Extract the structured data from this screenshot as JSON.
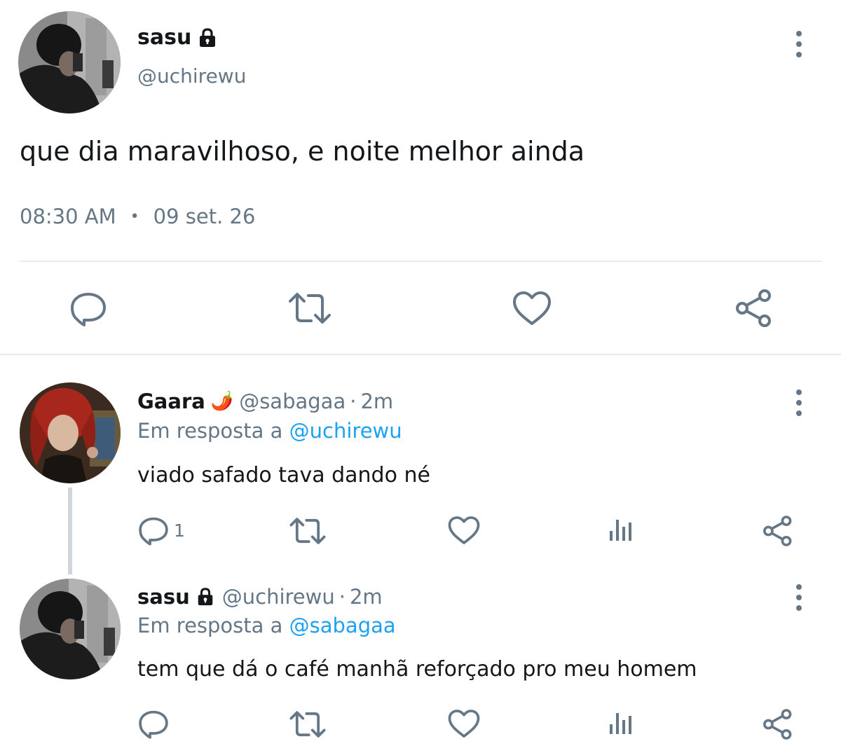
{
  "main_tweet": {
    "author": {
      "display_name": "sasu",
      "handle": "@uchirewu",
      "locked": true
    },
    "text": "que dia maravilhoso, e noite melhor ainda",
    "time": "08:30 AM",
    "separator": "•",
    "date": "09 set. 26",
    "icons": [
      "reply-icon",
      "retweet-icon",
      "like-icon",
      "share-icon"
    ]
  },
  "replies": [
    {
      "display_name": "Gaara",
      "emoji": "🌶️",
      "handle": "@sabagaa",
      "dot": "·",
      "time": "2m",
      "reply_prefix": "Em resposta a",
      "reply_to": "@uchirewu",
      "text": "viado safado tava dando né",
      "reply_count": "1"
    },
    {
      "display_name": "sasu",
      "locked": true,
      "handle": "@uchirewu",
      "dot": "·",
      "time": "2m",
      "reply_prefix": "Em resposta a",
      "reply_to": "@sabagaa",
      "text": "tem que dá o café manhã reforçado pro meu homem",
      "reply_count": ""
    }
  ],
  "colors": {
    "icon_gray": "#657786",
    "link_blue": "#1da1f2",
    "divider": "#e6ecf0",
    "text_dark": "#14171a"
  }
}
